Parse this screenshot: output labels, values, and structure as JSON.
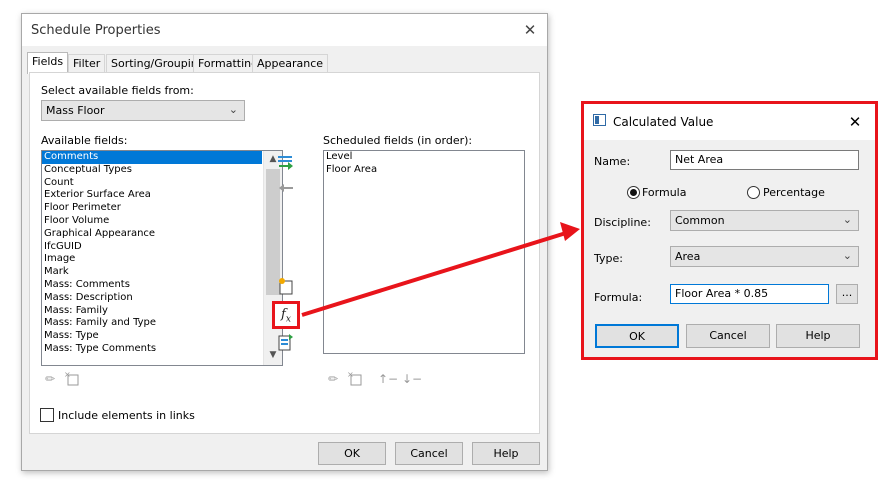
{
  "schedule_properties": {
    "title": "Schedule Properties",
    "close_glyph": "✕",
    "tabs": [
      {
        "label": "Fields",
        "active": true
      },
      {
        "label": "Filter"
      },
      {
        "label": "Sorting/Grouping"
      },
      {
        "label": "Formatting"
      },
      {
        "label": "Appearance"
      }
    ],
    "select_from_label": "Select available fields from:",
    "select_from_value": "Mass Floor",
    "available_label": "Available fields:",
    "available_fields": [
      "Comments",
      "Conceptual Types",
      "Count",
      "Exterior Surface Area",
      "Floor Perimeter",
      "Floor Volume",
      "Graphical Appearance",
      "IfcGUID",
      "Image",
      "Mark",
      "Mass: Comments",
      "Mass: Description",
      "Mass: Family",
      "Mass: Family and Type",
      "Mass: Type",
      "Mass: Type Comments"
    ],
    "selected_available": "Comments",
    "scheduled_label": "Scheduled fields (in order):",
    "scheduled_fields": [
      "Level",
      "Floor Area"
    ],
    "include_links_label": "Include elements in links",
    "include_links_checked": false,
    "ok_label": "OK",
    "cancel_label": "Cancel",
    "help_label": "Help",
    "formula_button_glyph": "fx",
    "highlight_color": "#e8141b"
  },
  "calculated_value": {
    "title": "Calculated Value",
    "close_glyph": "✕",
    "name_label": "Name:",
    "name_value": "Net Area",
    "formula_radio_label": "Formula",
    "percentage_radio_label": "Percentage",
    "selected_mode": "Formula",
    "discipline_label": "Discipline:",
    "discipline_value": "Common",
    "type_label": "Type:",
    "type_value": "Area",
    "formula_label": "Formula:",
    "formula_value": "Floor Area * 0.85",
    "browse_label": "...",
    "ok_label": "OK",
    "cancel_label": "Cancel",
    "help_label": "Help"
  },
  "icons": {
    "add_parameter": "add-parameter-icon",
    "remove_parameter": "remove-parameter-icon",
    "new_parameter": "new-parameter-icon",
    "calculated_value": "fx-icon",
    "combine_parameters": "combine-parameters-icon",
    "edit": "edit-pencil-icon",
    "delete": "delete-icon",
    "move_up": "move-up-icon",
    "move_down": "move-down-icon"
  }
}
